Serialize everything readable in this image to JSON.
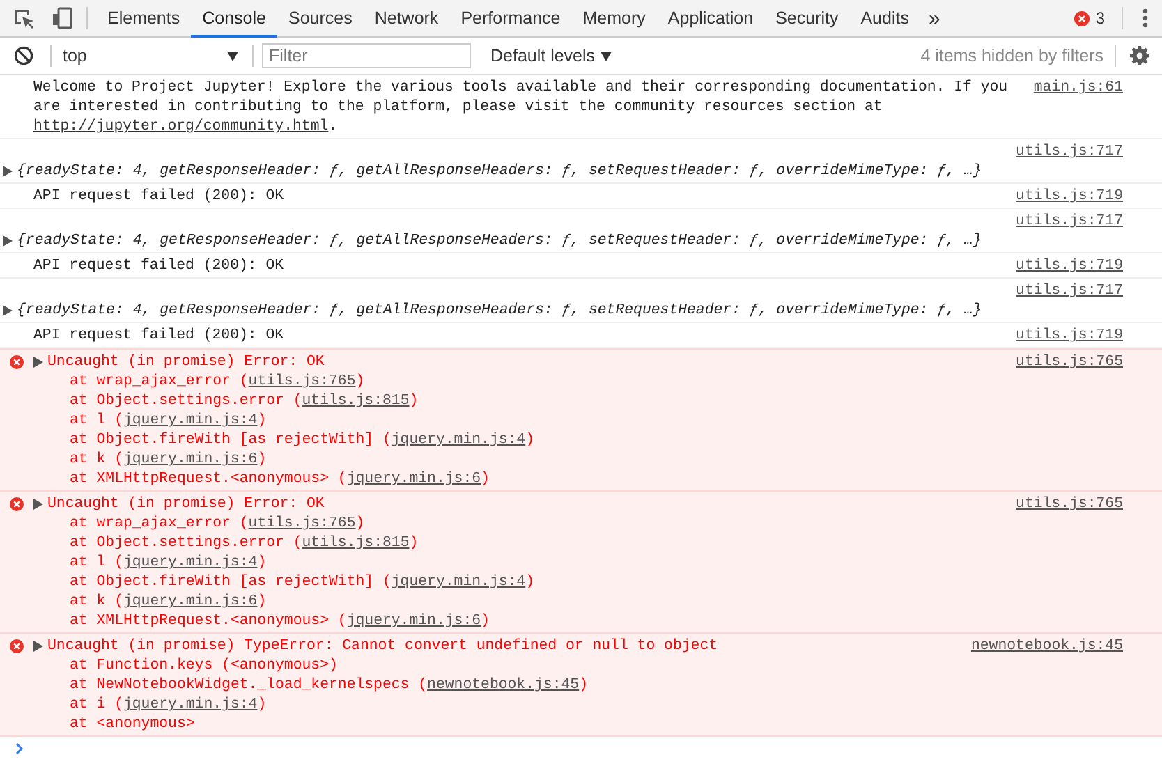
{
  "toolbar": {
    "tabs": [
      {
        "label": "Elements",
        "selected": false
      },
      {
        "label": "Console",
        "selected": true
      },
      {
        "label": "Sources",
        "selected": false
      },
      {
        "label": "Network",
        "selected": false
      },
      {
        "label": "Performance",
        "selected": false
      },
      {
        "label": "Memory",
        "selected": false
      },
      {
        "label": "Application",
        "selected": false
      },
      {
        "label": "Security",
        "selected": false
      },
      {
        "label": "Audits",
        "selected": false
      }
    ],
    "more_tabs": "»",
    "error_count": "3"
  },
  "filter_bar": {
    "context": "top",
    "filter": {
      "placeholder": "Filter"
    },
    "levels": "Default levels",
    "hidden_note": "4 items hidden by filters"
  },
  "console": {
    "messages": [
      {
        "kind": "log",
        "text": "Welcome to Project Jupyter! Explore the various tools available and their corresponding documentation. If you are interested in contributing to the platform, please visit the community resources section at ",
        "link": "http://jupyter.org/community.html",
        "link_end": ".",
        "source": "main.js:61"
      },
      {
        "kind": "object",
        "text": "{readyState: 4, getResponseHeader: ƒ, getAllResponseHeaders: ƒ, setRequestHeader: ƒ, overrideMimeType: ƒ, …}",
        "expanded": false,
        "source": "utils.js:717"
      },
      {
        "kind": "log",
        "text": "API request failed (200): OK",
        "source": "utils.js:719"
      },
      {
        "kind": "object",
        "text": "{readyState: 4, getResponseHeader: ƒ, getAllResponseHeaders: ƒ, setRequestHeader: ƒ, overrideMimeType: ƒ, …}",
        "expanded": false,
        "source": "utils.js:717"
      },
      {
        "kind": "log",
        "text": "API request failed (200): OK",
        "source": "utils.js:719"
      },
      {
        "kind": "object",
        "text": "{readyState: 4, getResponseHeader: ƒ, getAllResponseHeaders: ƒ, setRequestHeader: ƒ, overrideMimeType: ƒ, …}",
        "expanded": false,
        "source": "utils.js:717"
      },
      {
        "kind": "log",
        "text": "API request failed (200): OK",
        "source": "utils.js:719"
      },
      {
        "kind": "error",
        "text": "Uncaught (in promise) Error: OK",
        "expanded": false,
        "source": "utils.js:765",
        "frames": [
          {
            "text": "at wrap_ajax_error (",
            "link": "utils.js:765",
            "end": ")"
          },
          {
            "text": "at Object.settings.error (",
            "link": "utils.js:815",
            "end": ")"
          },
          {
            "text": "at l (",
            "link": "jquery.min.js:4",
            "end": ")"
          },
          {
            "text": "at Object.fireWith [as rejectWith] (",
            "link": "jquery.min.js:4",
            "end": ")"
          },
          {
            "text": "at k (",
            "link": "jquery.min.js:6",
            "end": ")"
          },
          {
            "text": "at XMLHttpRequest.<anonymous> (",
            "link": "jquery.min.js:6",
            "end": ")"
          }
        ]
      },
      {
        "kind": "error",
        "text": "Uncaught (in promise) Error: OK",
        "expanded": false,
        "source": "utils.js:765",
        "frames": [
          {
            "text": "at wrap_ajax_error (",
            "link": "utils.js:765",
            "end": ")"
          },
          {
            "text": "at Object.settings.error (",
            "link": "utils.js:815",
            "end": ")"
          },
          {
            "text": "at l (",
            "link": "jquery.min.js:4",
            "end": ")"
          },
          {
            "text": "at Object.fireWith [as rejectWith] (",
            "link": "jquery.min.js:4",
            "end": ")"
          },
          {
            "text": "at k (",
            "link": "jquery.min.js:6",
            "end": ")"
          },
          {
            "text": "at XMLHttpRequest.<anonymous> (",
            "link": "jquery.min.js:6",
            "end": ")"
          }
        ]
      },
      {
        "kind": "error",
        "text": "Uncaught (in promise) TypeError: Cannot convert undefined or null to object",
        "expanded": false,
        "source": "newnotebook.js:45",
        "frames": [
          {
            "text": "at Function.keys (<anonymous>)"
          },
          {
            "text": "at NewNotebookWidget._load_kernelspecs (",
            "link": "newnotebook.js:45",
            "end": ")"
          },
          {
            "text": "at i (",
            "link": "jquery.min.js:4",
            "end": ")"
          },
          {
            "text": "at <anonymous>"
          }
        ]
      }
    ]
  }
}
